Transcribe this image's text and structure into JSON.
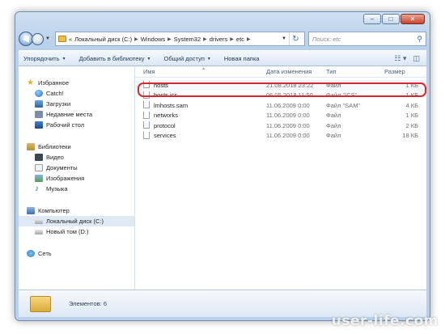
{
  "window": {
    "minimize": "–",
    "maximize": "□",
    "close": "✕"
  },
  "address": {
    "segments": [
      "«",
      "Локальный диск (C:)",
      "Windows",
      "System32",
      "drivers",
      "etc"
    ],
    "search_placeholder": "Поиск: etc"
  },
  "toolbar": {
    "organize": "Упорядочить",
    "add_to_library": "Добавить в библиотеку",
    "share": "Общий доступ",
    "new_folder": "Новая папка"
  },
  "sidebar": {
    "favorites": {
      "header": "Избранное",
      "items": [
        "Catch!",
        "Загрузки",
        "Недавние места",
        "Рабочий стол"
      ]
    },
    "libraries": {
      "header": "Библиотеки",
      "items": [
        "Видео",
        "Документы",
        "Изображения",
        "Музыка"
      ]
    },
    "computer": {
      "header": "Компьютер",
      "items": [
        "Локальный диск (C:)",
        "Новый том (D:)"
      ]
    },
    "network": {
      "header": "Сеть"
    }
  },
  "columns": {
    "name": "Имя",
    "date": "Дата изменения",
    "type": "Тип",
    "size": "Размер"
  },
  "files": [
    {
      "name": "hosts",
      "date": "21.08.2018 23:22",
      "type": "Файл",
      "size": "1 КБ"
    },
    {
      "name": "hosts.ics",
      "date": "06.05.2018 11:50",
      "type": "Файл \"ICS\"",
      "size": "1 КБ"
    },
    {
      "name": "lmhosts.sam",
      "date": "11.06.2009 0:00",
      "type": "Файл \"SAM\"",
      "size": "4 КБ"
    },
    {
      "name": "networks",
      "date": "11.06.2009 0:00",
      "type": "Файл",
      "size": "1 КБ"
    },
    {
      "name": "protocol",
      "date": "11.06.2009 0:00",
      "type": "Файл",
      "size": "2 КБ"
    },
    {
      "name": "services",
      "date": "11.06.2009 0:00",
      "type": "Файл",
      "size": "18 КБ"
    }
  ],
  "details": {
    "count": "Элементов: 6"
  },
  "watermark": "user-life.com"
}
